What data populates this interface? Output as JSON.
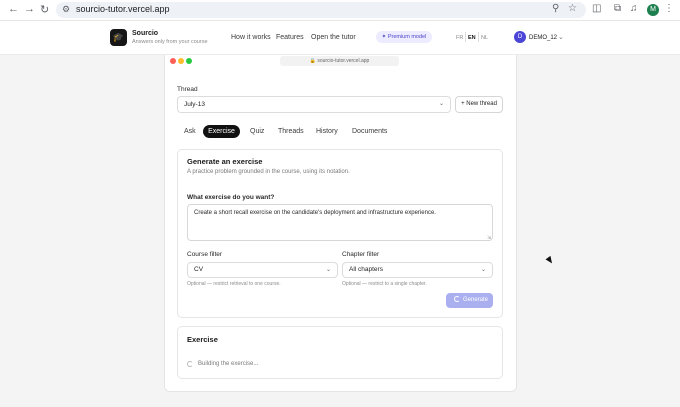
{
  "browser": {
    "url": "sourcio-tutor.vercel.app",
    "profile_initial": "M"
  },
  "app": {
    "brand": "Sourcio",
    "tagline": "Answers only from your course",
    "nav": [
      "How it works",
      "Features",
      "Open the tutor"
    ],
    "premium_badge": "Premium model",
    "languages": [
      "FR",
      "EN",
      "NL"
    ],
    "active_language": "EN",
    "user_initial": "D",
    "user_name": "DEMO_12"
  },
  "window": {
    "url": "sourcio-tutor.vercel.app"
  },
  "thread": {
    "label": "Thread",
    "selected": "July-13",
    "new_thread_label": "+ New thread"
  },
  "tabs": [
    "Ask",
    "Exercise",
    "Quiz",
    "Threads",
    "History",
    "Documents"
  ],
  "active_tab": "Exercise",
  "generate": {
    "title": "Generate an exercise",
    "subtitle": "A practice problem grounded in the course, using its notation.",
    "prompt_label": "What exercise do you want?",
    "prompt_value": "Create a short recall exercise on the candidate's deployment and infrastructure experience.",
    "course_filter_label": "Course filter",
    "course_filter_value": "CV",
    "course_filter_hint": "Optional — restrict retrieval to one course.",
    "chapter_filter_label": "Chapter filter",
    "chapter_filter_value": "All chapters",
    "chapter_filter_hint": "Optional — restrict to a single chapter.",
    "button_label": "Generate"
  },
  "exercise": {
    "title": "Exercise",
    "status": "Building the exercise..."
  },
  "colors": {
    "accent": "#4b46c8",
    "button_disabled": "#aab0ef",
    "active_tab": "#111111"
  }
}
